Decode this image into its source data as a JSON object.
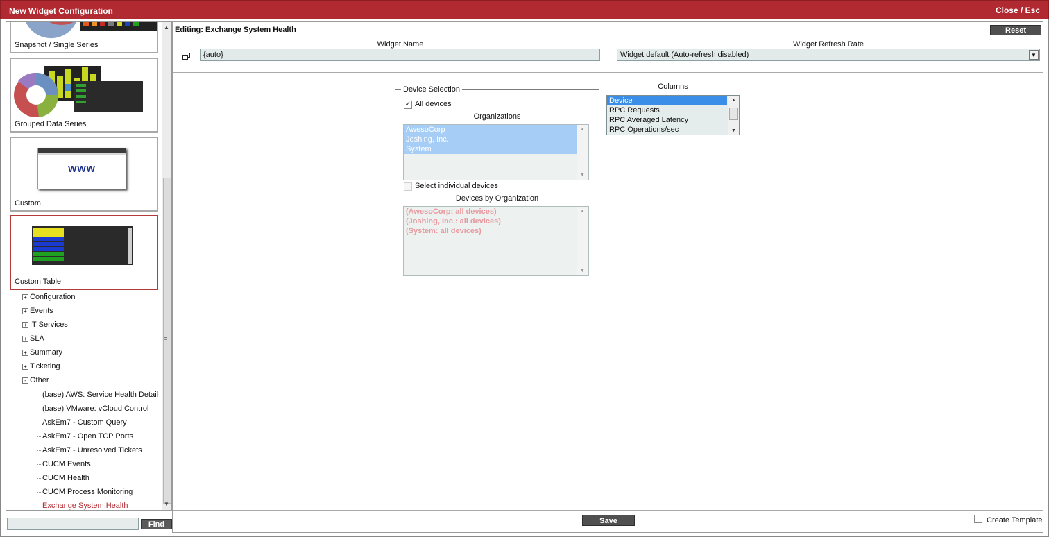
{
  "window": {
    "title": "New Widget Configuration",
    "close_label": "Close / Esc"
  },
  "sidebar": {
    "tiles": [
      {
        "caption": "Snapshot / Single Series"
      },
      {
        "caption": "Grouped Data Series"
      },
      {
        "caption": "Custom",
        "thumb_text": "WWW"
      },
      {
        "caption": "Custom Table"
      }
    ],
    "tree": [
      {
        "label": "Configuration",
        "state": "+"
      },
      {
        "label": "Events",
        "state": "+"
      },
      {
        "label": "IT Services",
        "state": "+"
      },
      {
        "label": "SLA",
        "state": "+"
      },
      {
        "label": "Summary",
        "state": "+"
      },
      {
        "label": "Ticketing",
        "state": "+"
      },
      {
        "label": "Other",
        "state": "-"
      }
    ],
    "other_items": [
      "(base) AWS: Service Health Detail",
      "(base) VMware: vCloud Control",
      "AskEm7 - Custom Query",
      "AskEm7 - Open TCP Ports",
      "AskEm7 - Unresolved Tickets",
      "CUCM Events",
      "CUCM Health",
      "CUCM Process Monitoring",
      "Exchange System Health"
    ],
    "find_label": "Find",
    "find_value": ""
  },
  "main": {
    "editing_title": "Editing: Exchange System Health",
    "reset_label": "Reset",
    "widget_name_label": "Widget Name",
    "widget_name_value": "{auto}",
    "refresh_label": "Widget Refresh Rate",
    "refresh_value": "Widget default (Auto-refresh disabled)",
    "device_selection": {
      "legend": "Device Selection",
      "all_devices_label": "All devices",
      "all_devices_checked": true,
      "organizations_label": "Organizations",
      "organizations": [
        "AwesoCorp",
        "Joshing, Inc.",
        "System"
      ],
      "select_individual_label": "Select individual devices",
      "devices_by_org_label": "Devices by Organization",
      "devices_by_org": [
        "(AwesoCorp: all devices)",
        "(Joshing, Inc.: all devices)",
        "(System: all devices)"
      ]
    },
    "columns_label": "Columns",
    "columns": [
      "Device",
      "RPC Requests",
      "RPC Averaged Latency",
      "RPC Operations/sec"
    ],
    "save_label": "Save",
    "create_template_label": "Create Template"
  }
}
